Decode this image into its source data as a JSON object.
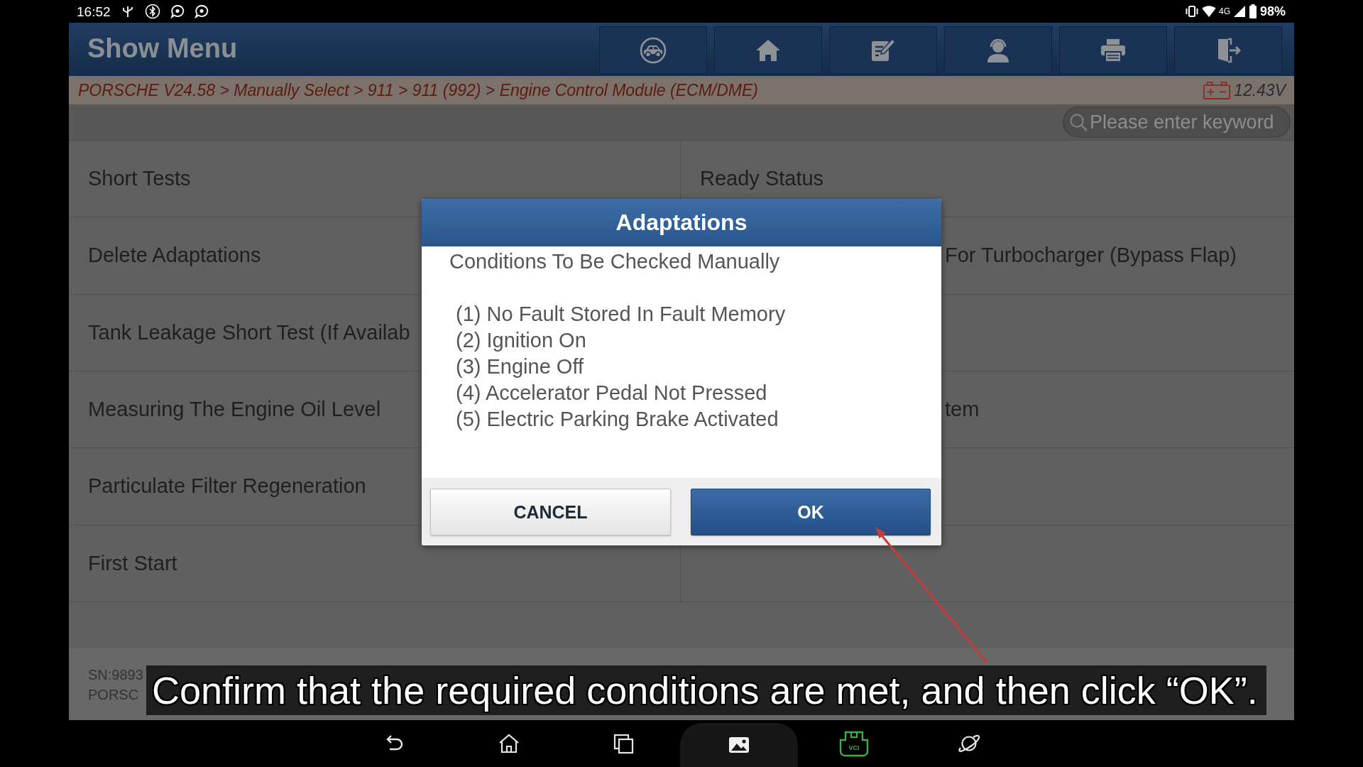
{
  "status_bar": {
    "time": "16:52",
    "network": "4G",
    "battery": "98%"
  },
  "header": {
    "title": "Show Menu"
  },
  "breadcrumb": {
    "path": "PORSCHE V24.58 > Manually Select > 911 > 911 (992) > Engine Control Module (ECM/DME)",
    "voltage": "12.43V"
  },
  "search": {
    "placeholder": "Please enter keyword"
  },
  "menu": {
    "rows": [
      {
        "left": {
          "label": "Short Tests"
        },
        "right": {
          "label": "Ready Status"
        }
      },
      {
        "left": {
          "label": "Delete Adaptations"
        },
        "right": {
          "label": "For Turbocharger (Bypass Flap)"
        }
      },
      {
        "left": {
          "label": "Tank Leakage Short Test (If Availab"
        }
      },
      {
        "left": {
          "label": "Measuring The Engine Oil Level"
        },
        "right": {
          "label": "tem"
        }
      },
      {
        "left": {
          "label": "Particulate Filter Regeneration"
        }
      },
      {
        "left": {
          "label": "First Start"
        }
      }
    ]
  },
  "dialog": {
    "title": "Adaptations",
    "heading": "Conditions To Be Checked Manually",
    "conditions": [
      "(1) No Fault Stored In Fault Memory",
      "(2) Ignition On",
      "(3) Engine Off",
      "(4) Accelerator Pedal Not Pressed",
      "(5) Electric Parking Brake Activated"
    ],
    "buttons": [
      {
        "label": "CANCEL",
        "kind": "secondary"
      },
      {
        "label": "OK",
        "kind": "primary"
      }
    ]
  },
  "footer": {
    "serial": "SN:9893",
    "vehicle": "PORSC"
  },
  "nav_bar": {
    "vci_label": "VCI"
  },
  "caption": "Confirm that the required conditions are met, and then click “OK”."
}
